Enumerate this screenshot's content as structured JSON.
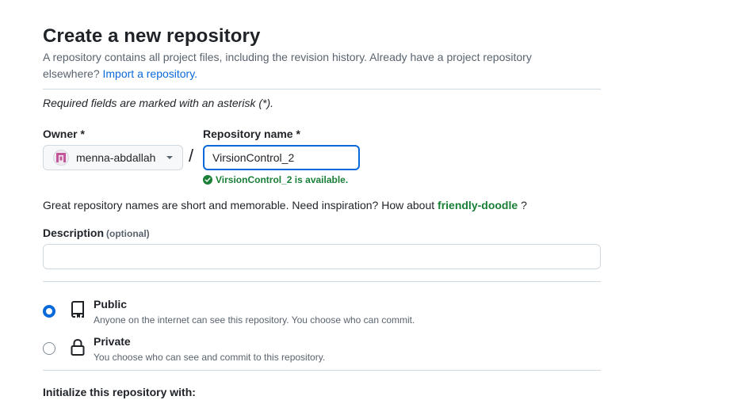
{
  "page": {
    "title": "Create a new repository",
    "subtitle": "A repository contains all project files, including the revision history. Already have a project repository elsewhere?",
    "import_link": "Import a repository.",
    "required_note": "Required fields are marked with an asterisk (*)."
  },
  "owner": {
    "label": "Owner *",
    "value": "menna-abdallah"
  },
  "separator": "/",
  "repository": {
    "label": "Repository name *",
    "value": "VirsionControl_2",
    "availability": "VirsionControl_2 is available."
  },
  "suggestion": {
    "text": "Great repository names are short and memorable. Need inspiration? How about",
    "name": "friendly-doodle",
    "suffix": "?"
  },
  "description": {
    "label": "Description",
    "optional": "(optional)",
    "value": ""
  },
  "visibility": {
    "selected": "public",
    "options": [
      {
        "title": "Public",
        "description": "Anyone on the internet can see this repository. You choose who can commit."
      },
      {
        "title": "Private",
        "description": "You choose who can see and commit to this repository."
      }
    ]
  },
  "initialize": {
    "heading": "Initialize this repository with:"
  },
  "colors": {
    "accent": "#0969da",
    "success": "#1a7f37",
    "muted": "#59636e",
    "border": "#d1d9e0"
  }
}
